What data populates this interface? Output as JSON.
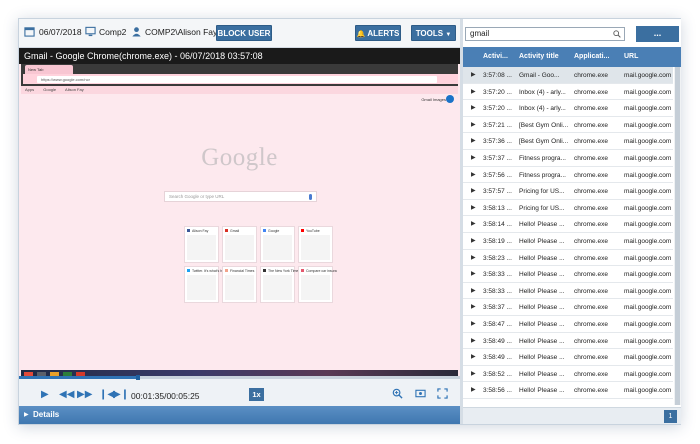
{
  "toolbar": {
    "date": "06/07/2018",
    "computer": "Comp2",
    "user": "COMP2\\Alison Fay",
    "block_user_label": "BLOCK USER",
    "alerts_label": "ALERTS",
    "tools_label": "TOOLS"
  },
  "player": {
    "window_title": "Gmail - Google Chrome(chrome.exe) - 06/07/2018 03:57:08",
    "progress_fraction": 0.27,
    "time": "00:01:35/00:05:25",
    "speed": "1x",
    "details_label": "Details"
  },
  "screen": {
    "tab_label": "New Tab",
    "url": "https://www.google.com/ncr",
    "bookmarks": [
      "Apps",
      "Google",
      "Alison Fay"
    ],
    "top_links": "Gmail  Images",
    "logo": "Google",
    "search_placeholder": "Search Google or type URL",
    "tiles": [
      {
        "label": "Alison Fay",
        "color": "#3b5998"
      },
      {
        "label": "Gmail",
        "color": "#d93025"
      },
      {
        "label": "Google",
        "color": "#4285f4"
      },
      {
        "label": "YouTube",
        "color": "#ff0000"
      },
      {
        "label": "Twitter. It's what's h",
        "color": "#1da1f2"
      },
      {
        "label": "Financial Times",
        "color": "#f1a38b"
      },
      {
        "label": "The New York Times",
        "color": "#333333"
      },
      {
        "label": "Compare car insura",
        "color": "#e4576d"
      }
    ]
  },
  "search": {
    "value": "gmail",
    "more_label": "..."
  },
  "table": {
    "columns": [
      "Activi...",
      "Activity title",
      "Applicati...",
      "URL"
    ],
    "rows": [
      [
        "3:57:08 ...",
        "Gmail - Goo...",
        "chrome.exe",
        "mail.google.com"
      ],
      [
        "3:57:20 ...",
        "Inbox (4) - arly...",
        "chrome.exe",
        "mail.google.com"
      ],
      [
        "3:57:20 ...",
        "Inbox (4) - arly...",
        "chrome.exe",
        "mail.google.com"
      ],
      [
        "3:57:21 ...",
        "[Best Gym Onli...",
        "chrome.exe",
        "mail.google.com"
      ],
      [
        "3:57:36 ...",
        "[Best Gym Onli...",
        "chrome.exe",
        "mail.google.com"
      ],
      [
        "3:57:37 ...",
        "Fitness progra...",
        "chrome.exe",
        "mail.google.com"
      ],
      [
        "3:57:56 ...",
        "Fitness progra...",
        "chrome.exe",
        "mail.google.com"
      ],
      [
        "3:57:57 ...",
        "Pricing for US...",
        "chrome.exe",
        "mail.google.com"
      ],
      [
        "3:58:13 ...",
        "Pricing for US...",
        "chrome.exe",
        "mail.google.com"
      ],
      [
        "3:58:14 ...",
        "Hello! Please ...",
        "chrome.exe",
        "mail.google.com"
      ],
      [
        "3:58:19 ...",
        "Hello! Please ...",
        "chrome.exe",
        "mail.google.com"
      ],
      [
        "3:58:23 ...",
        "Hello! Please ...",
        "chrome.exe",
        "mail.google.com"
      ],
      [
        "3:58:33 ...",
        "Hello! Please ...",
        "chrome.exe",
        "mail.google.com"
      ],
      [
        "3:58:33 ...",
        "Hello! Please ...",
        "chrome.exe",
        "mail.google.com"
      ],
      [
        "3:58:37 ...",
        "Hello! Please ...",
        "chrome.exe",
        "mail.google.com"
      ],
      [
        "3:58:47 ...",
        "Hello! Please ...",
        "chrome.exe",
        "mail.google.com"
      ],
      [
        "3:58:49 ...",
        "Hello! Please ...",
        "chrome.exe",
        "mail.google.com"
      ],
      [
        "3:58:49 ...",
        "Hello! Please ...",
        "chrome.exe",
        "mail.google.com"
      ],
      [
        "3:58:52 ...",
        "Hello! Please ...",
        "chrome.exe",
        "mail.google.com"
      ],
      [
        "3:58:56 ...",
        "Hello! Please ...",
        "chrome.exe",
        "mail.google.com"
      ]
    ],
    "selected_index": 0,
    "page": "1"
  },
  "colors": {
    "accent": "#3b6fa0",
    "header": "#4a7fb5",
    "screen_bg": "#fde9ee"
  }
}
